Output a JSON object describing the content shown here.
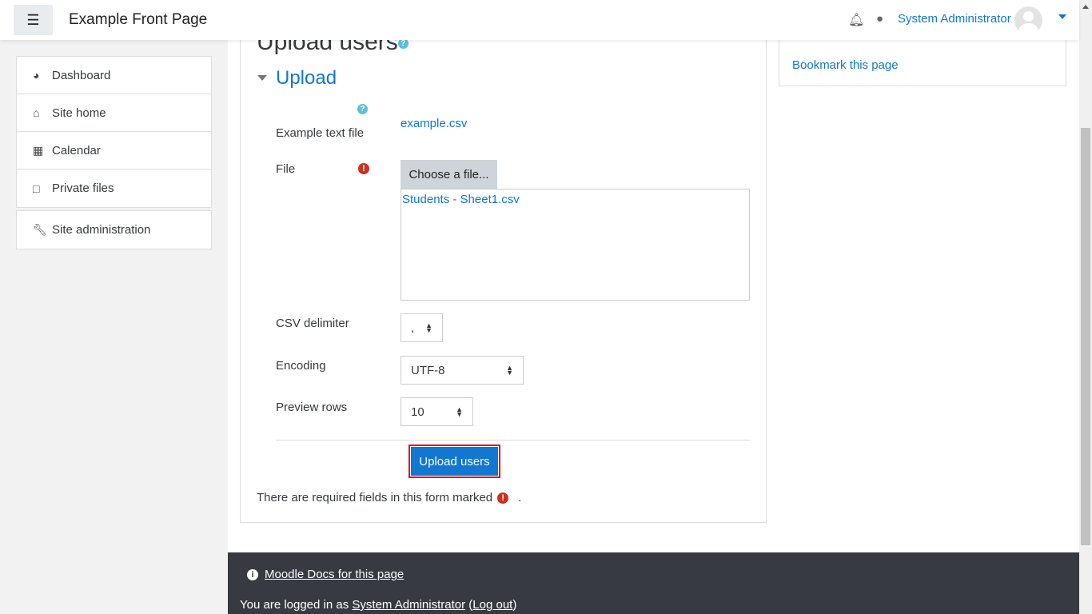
{
  "navbar": {
    "brand": "Example Front Page",
    "user_name": "System Administrator"
  },
  "sidebar": {
    "items": [
      {
        "label": "Dashboard",
        "icon": "dashboard-icon"
      },
      {
        "label": "Site home",
        "icon": "home-icon"
      },
      {
        "label": "Calendar",
        "icon": "calendar-icon"
      },
      {
        "label": "Private files",
        "icon": "file-icon"
      }
    ],
    "admin": {
      "label": "Site administration",
      "icon": "wrench-icon"
    }
  },
  "main": {
    "title": "Upload users",
    "section": "Upload",
    "example_label": "Example text file",
    "example_link": "example.csv",
    "file_label": "File",
    "choose_button": "Choose a file...",
    "selected_file": "Students - Sheet1.csv",
    "delimiter_label": "CSV delimiter",
    "delimiter_value": ",",
    "encoding_label": "Encoding",
    "encoding_value": "UTF-8",
    "preview_label": "Preview rows",
    "preview_value": "10",
    "submit": "Upload users",
    "required_note": "There are required fields in this form marked",
    "required_tail": "."
  },
  "right_block": {
    "bookmark": "Bookmark this page"
  },
  "footer": {
    "docs": "Moodle Docs for this page",
    "logged_prefix": "You are logged in as",
    "user": "System Administrator",
    "logout": "Log out"
  },
  "colors": {
    "link": "#1177d1",
    "required": "#ca3120",
    "highlight": "#e0121f"
  }
}
